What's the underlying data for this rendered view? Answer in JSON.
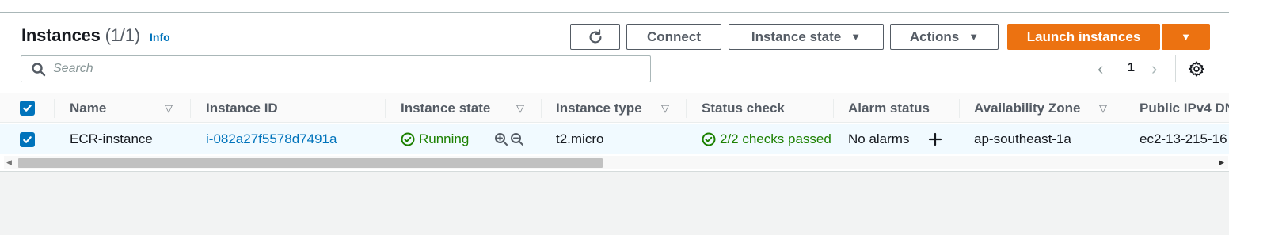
{
  "header": {
    "title": "Instances",
    "count": "(1/1)",
    "info": "Info"
  },
  "toolbar": {
    "connect": "Connect",
    "instance_state": "Instance state",
    "actions": "Actions",
    "launch": "Launch instances",
    "caret": "▼"
  },
  "search": {
    "placeholder": "Search"
  },
  "pagination": {
    "page": "1"
  },
  "table": {
    "columns": [
      "Name",
      "Instance ID",
      "Instance state",
      "Instance type",
      "Status check",
      "Alarm status",
      "Availability Zone",
      "Public IPv4 DN"
    ],
    "rows": [
      {
        "name": "ECR-instance",
        "instance_id": "i-082a27f5578d7491a",
        "state": "Running",
        "type": "t2.micro",
        "status_check": "2/2 checks passed",
        "alarm": "No alarms",
        "zone": "ap-southeast-1a",
        "public_dns": "ec2-13-215-16"
      }
    ]
  },
  "colors": {
    "accent_orange": "#ec7211",
    "link_blue": "#0073bb",
    "success_green": "#1d8102"
  }
}
